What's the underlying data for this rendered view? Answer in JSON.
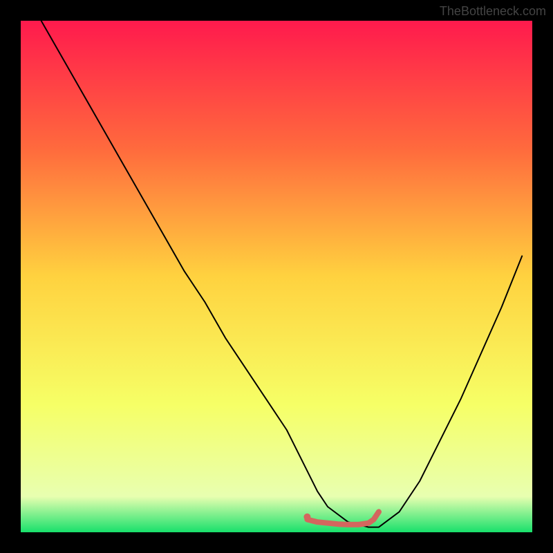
{
  "attribution": "TheBottleneck.com",
  "chart_data": {
    "type": "line",
    "title": "",
    "xlabel": "",
    "ylabel": "",
    "xlim": [
      0,
      100
    ],
    "ylim": [
      0,
      100
    ],
    "gradient_stops": [
      {
        "offset": 0,
        "color": "#ff1a4d"
      },
      {
        "offset": 25,
        "color": "#ff6a3d"
      },
      {
        "offset": 50,
        "color": "#ffd23f"
      },
      {
        "offset": 75,
        "color": "#f6ff66"
      },
      {
        "offset": 93,
        "color": "#e8ffb0"
      },
      {
        "offset": 100,
        "color": "#18e06b"
      }
    ],
    "series": [
      {
        "name": "bottleneck-curve",
        "color": "#000000",
        "width": 2,
        "x": [
          4,
          8,
          12,
          16,
          20,
          24,
          28,
          32,
          36,
          40,
          44,
          48,
          52,
          56,
          58,
          60,
          64,
          68,
          70,
          74,
          78,
          82,
          86,
          90,
          94,
          98
        ],
        "y": [
          100,
          93,
          86,
          79,
          72,
          65,
          58,
          51,
          45,
          38,
          32,
          26,
          20,
          12,
          8,
          5,
          2,
          1,
          1,
          4,
          10,
          18,
          26,
          35,
          44,
          54
        ]
      },
      {
        "name": "highlight-segment",
        "color": "#d4665e",
        "width": 8,
        "x": [
          56,
          58,
          60,
          62,
          64,
          66,
          68,
          69,
          70
        ],
        "y": [
          2.5,
          2,
          1.8,
          1.6,
          1.5,
          1.5,
          1.8,
          2.5,
          4
        ]
      }
    ],
    "highlight_point": {
      "x": 56,
      "y": 3,
      "color": "#d4665e",
      "r": 5
    }
  }
}
